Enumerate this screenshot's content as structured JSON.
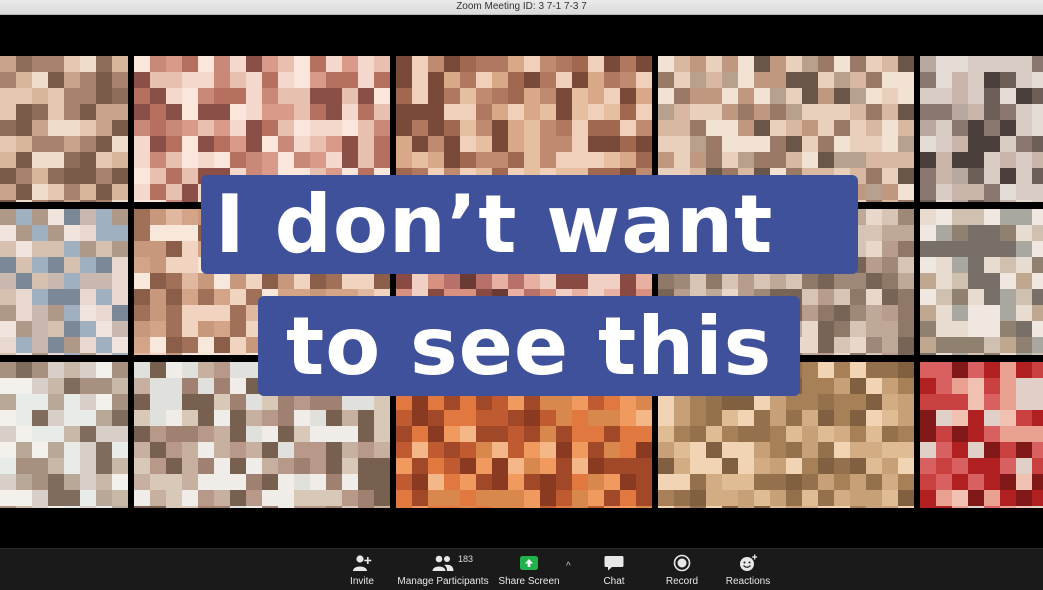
{
  "window": {
    "title": "Zoom Meeting ID: 3  7-1  7-3  7"
  },
  "overlay": {
    "line1": "I don’t want",
    "line2": "to see this"
  },
  "toolbar": {
    "invite": {
      "label": "Invite",
      "icon": "add-person-icon"
    },
    "participants": {
      "label": "Manage Participants",
      "count": "183",
      "icon": "people-icon"
    },
    "share": {
      "label": "Share Screen",
      "icon": "share-screen-icon",
      "caret": "^"
    },
    "chat": {
      "label": "Chat",
      "icon": "chat-bubble-icon"
    },
    "record": {
      "label": "Record",
      "icon": "record-icon"
    },
    "reactions": {
      "label": "Reactions",
      "icon": "emoji-plus-icon"
    }
  },
  "colors": {
    "banner": "#3f519b",
    "toolbar": "#1a1a1a",
    "share_green": "#22b24c"
  }
}
